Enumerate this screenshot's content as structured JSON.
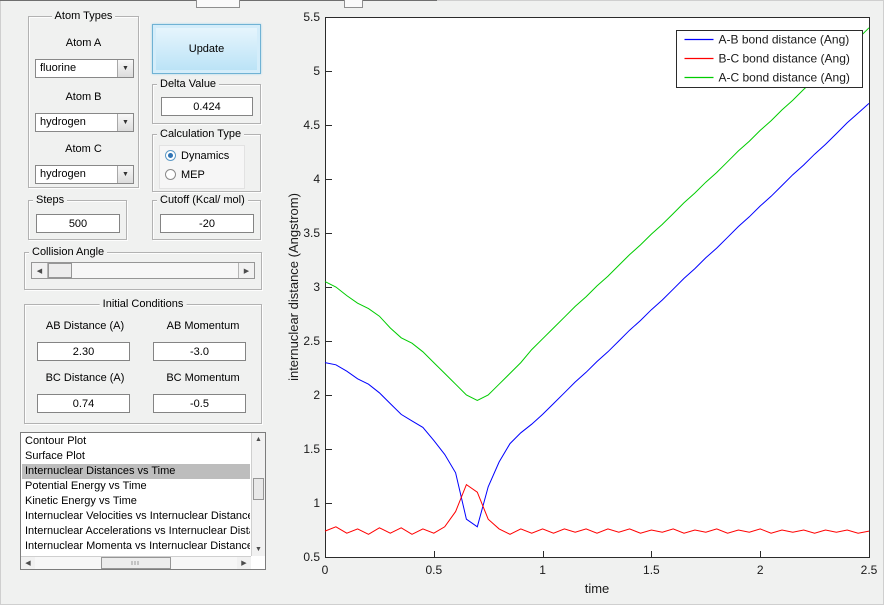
{
  "icons": {
    "dropdown": "▼",
    "scroll_left": "◀",
    "scroll_right": "▶",
    "scroll_up": "▲",
    "scroll_down": "▼"
  },
  "controls": {
    "atom_types": {
      "title": "Atom Types",
      "atom_a_label": "Atom A",
      "atom_a_value": "fluorine",
      "atom_b_label": "Atom B",
      "atom_b_value": "hydrogen",
      "atom_c_label": "Atom C",
      "atom_c_value": "hydrogen"
    },
    "update_label": "Update",
    "delta": {
      "title": "Delta Value",
      "value": "0.424"
    },
    "calculation": {
      "title": "Calculation Type",
      "dynamics_label": "Dynamics",
      "mep_label": "MEP",
      "selected": "Dynamics"
    },
    "steps": {
      "title": "Steps",
      "value": "500"
    },
    "cutoff": {
      "title": "Cutoff (Kcal/ mol)",
      "value": "-20"
    },
    "collision_angle": {
      "title": "Collision Angle"
    },
    "initial_conditions": {
      "title": "Initial Conditions",
      "ab_distance_label": "AB Distance (A)",
      "ab_distance_value": "2.30",
      "ab_momentum_label": "AB Momentum",
      "ab_momentum_value": "-3.0",
      "bc_distance_label": "BC Distance (A)",
      "bc_distance_value": "0.74",
      "bc_momentum_label": "BC Momentum",
      "bc_momentum_value": "-0.5"
    }
  },
  "plot_list": {
    "items": [
      "Contour Plot",
      "Surface Plot",
      "Internuclear Distances vs Time",
      "Potential Energy vs Time",
      "Kinetic Energy vs Time",
      "Internuclear Velocities vs Internuclear Distance",
      "Internuclear Accelerations vs Internuclear Dista",
      "Internuclear Momenta vs Internuclear Distance"
    ],
    "selected_index": 2
  },
  "chart_data": {
    "type": "line",
    "title": "",
    "xlabel": "time",
    "ylabel": "internuclear distance (Angstrom)",
    "xlim": [
      0,
      2.5
    ],
    "ylim": [
      0.5,
      5.5
    ],
    "xticks": [
      0,
      0.5,
      1,
      1.5,
      2,
      2.5
    ],
    "yticks": [
      0.5,
      1,
      1.5,
      2,
      2.5,
      3,
      3.5,
      4,
      4.5,
      5,
      5.5
    ],
    "grid": false,
    "legend_position": "northeast",
    "x": [
      0,
      0.05,
      0.1,
      0.15,
      0.2,
      0.25,
      0.3,
      0.35,
      0.4,
      0.45,
      0.5,
      0.55,
      0.6,
      0.65,
      0.7,
      0.75,
      0.8,
      0.85,
      0.9,
      0.95,
      1,
      1.05,
      1.1,
      1.15,
      1.2,
      1.25,
      1.3,
      1.35,
      1.4,
      1.45,
      1.5,
      1.55,
      1.6,
      1.65,
      1.7,
      1.75,
      1.8,
      1.85,
      1.9,
      1.95,
      2,
      2.05,
      2.1,
      2.15,
      2.2,
      2.25,
      2.3,
      2.35,
      2.4,
      2.45,
      2.5
    ],
    "series": [
      {
        "name": "A-B bond distance (Ang)",
        "color": "#0000ff",
        "values": [
          2.3,
          2.28,
          2.22,
          2.15,
          2.1,
          2.02,
          1.92,
          1.82,
          1.76,
          1.7,
          1.58,
          1.45,
          1.28,
          0.85,
          0.78,
          1.15,
          1.38,
          1.55,
          1.65,
          1.73,
          1.82,
          1.92,
          2.02,
          2.12,
          2.21,
          2.31,
          2.4,
          2.5,
          2.6,
          2.69,
          2.79,
          2.88,
          2.98,
          3.08,
          3.17,
          3.27,
          3.36,
          3.46,
          3.56,
          3.65,
          3.75,
          3.84,
          3.94,
          4.04,
          4.13,
          4.23,
          4.32,
          4.42,
          4.52,
          4.61,
          4.7
        ]
      },
      {
        "name": "B-C bond distance (Ang)",
        "color": "#ff0000",
        "values": [
          0.74,
          0.78,
          0.72,
          0.76,
          0.71,
          0.77,
          0.72,
          0.77,
          0.71,
          0.76,
          0.72,
          0.78,
          0.92,
          1.17,
          1.1,
          0.85,
          0.76,
          0.71,
          0.76,
          0.72,
          0.76,
          0.72,
          0.76,
          0.73,
          0.76,
          0.72,
          0.76,
          0.73,
          0.76,
          0.72,
          0.75,
          0.73,
          0.76,
          0.72,
          0.75,
          0.73,
          0.76,
          0.72,
          0.75,
          0.73,
          0.76,
          0.72,
          0.75,
          0.73,
          0.75,
          0.72,
          0.75,
          0.73,
          0.75,
          0.72,
          0.74
        ]
      },
      {
        "name": "A-C bond distance (Ang)",
        "color": "#00cc00",
        "values": [
          3.05,
          3,
          2.92,
          2.85,
          2.8,
          2.73,
          2.62,
          2.53,
          2.48,
          2.4,
          2.3,
          2.2,
          2.1,
          2,
          1.95,
          2,
          2.1,
          2.2,
          2.3,
          2.42,
          2.52,
          2.62,
          2.72,
          2.82,
          2.91,
          3.01,
          3.1,
          3.2,
          3.3,
          3.39,
          3.49,
          3.58,
          3.68,
          3.78,
          3.87,
          3.97,
          4.06,
          4.16,
          4.26,
          4.35,
          4.45,
          4.54,
          4.64,
          4.73,
          4.83,
          4.92,
          5.02,
          5.11,
          5.21,
          5.3,
          5.4
        ]
      }
    ]
  }
}
